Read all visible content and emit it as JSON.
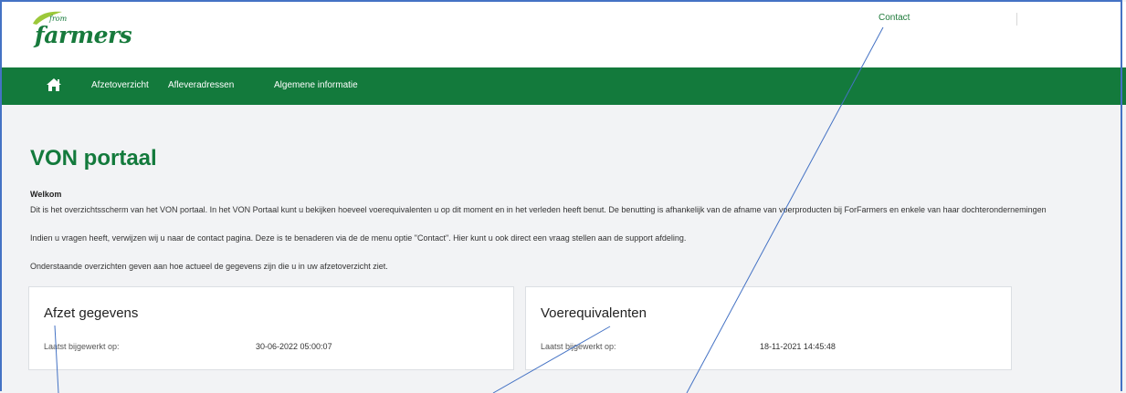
{
  "header": {
    "logo_small": "from",
    "logo_word": "farmers",
    "contact_label": "Contact"
  },
  "nav": {
    "home_icon": "home-icon",
    "items": [
      {
        "label": "Afzetoverzicht"
      },
      {
        "label": "Afleveradressen"
      },
      {
        "label": "Algemene informatie"
      }
    ]
  },
  "main": {
    "title": "VON portaal",
    "welcome_heading": "Welkom",
    "paragraphs": [
      "Dit is het overzichtsscherm van het VON portaal. In het VON Portaal kunt u bekijken hoeveel voerequivalenten u op dit moment en in het verleden heeft benut. De benutting is afhankelijk van de afname van voerproducten bij ForFarmers en enkele van haar dochterondernemingen",
      "Indien u vragen heeft, verwijzen wij u naar de contact pagina. Deze is te benaderen via de de menu optie \"Contact\". Hier kunt u ook direct een vraag stellen aan de support afdeling.",
      "Onderstaande overzichten geven aan hoe actueel de gegevens zijn die u in uw afzetoverzicht ziet."
    ]
  },
  "cards": [
    {
      "title": "Afzet gegevens",
      "label": "Laatst bijgewerkt op:",
      "value": "30-06-2022 05:00:07"
    },
    {
      "title": "Voerequivalenten",
      "label": "Laatst bijgewerkt op:",
      "value": "18-11-2021 14:45:48"
    }
  ],
  "colors": {
    "brand_green": "#137a3c",
    "annotation_blue": "#4472c4"
  }
}
